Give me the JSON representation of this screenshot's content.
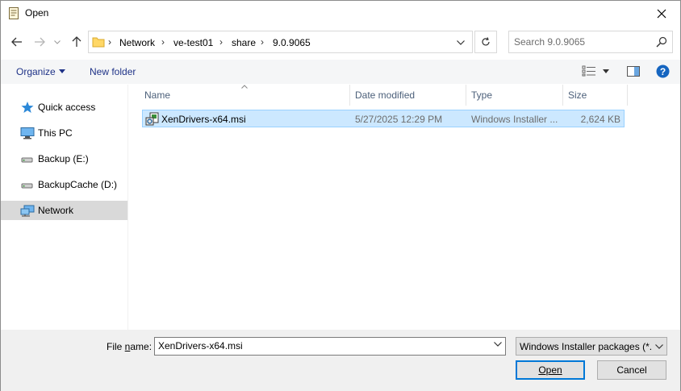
{
  "window": {
    "title": "Open"
  },
  "address": {
    "crumbs": [
      "Network",
      "ve-test01",
      "share",
      "9.0.9065"
    ]
  },
  "search": {
    "placeholder": "Search 9.0.9065"
  },
  "toolbar": {
    "organize_label": "Organize",
    "new_folder_label": "New folder"
  },
  "nav": {
    "items": [
      {
        "label": "Quick access",
        "icon": "star-icon"
      },
      {
        "label": "This PC",
        "icon": "computer-icon"
      },
      {
        "label": "Backup (E:)",
        "icon": "drive-icon"
      },
      {
        "label": "BackupCache (D:)",
        "icon": "drive-icon"
      },
      {
        "label": "Network",
        "icon": "network-icon",
        "selected": true
      }
    ]
  },
  "columns": {
    "name": "Name",
    "date": "Date modified",
    "type": "Type",
    "size": "Size"
  },
  "files": [
    {
      "name": "XenDrivers-x64.msi",
      "date": "5/27/2025 12:29 PM",
      "type": "Windows Installer ...",
      "size": "2,624 KB"
    }
  ],
  "bottom": {
    "file_name_label_prefix": "File ",
    "file_name_label_underlined": "n",
    "file_name_label_suffix": "ame:",
    "file_name_value": "XenDrivers-x64.msi",
    "filter_value": "Windows Installer packages (*.r",
    "open_label": "Open",
    "cancel_label": "Cancel"
  },
  "colors": {
    "selection_bg": "#cce8ff",
    "selection_border": "#99d1ff",
    "link_text": "#1e3287",
    "accent": "#0078d7"
  }
}
